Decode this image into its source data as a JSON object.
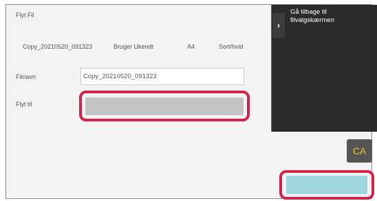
{
  "window": {
    "title": "Flyt Fil"
  },
  "file_info": {
    "filename": "Copy_20210520_091323",
    "user": "Bruger Ukendt",
    "paper_size": "A4",
    "color_mode": "Sort/hvid"
  },
  "form": {
    "filename_label": "Filnavn",
    "filename_value": "Copy_20210520_091323",
    "move_to_label": "Flyt til",
    "colon": ":"
  },
  "side_panel": {
    "back_label": "Gå tilbage til filvalgskærmen",
    "back_icon": "chevron-right-icon"
  },
  "buttons": {
    "ca_label": "CA"
  },
  "colors": {
    "highlight": "#d4234a",
    "ok_button": "#9fd6de",
    "ca_text": "#f0c030",
    "side_panel": "#2b2b2b"
  }
}
